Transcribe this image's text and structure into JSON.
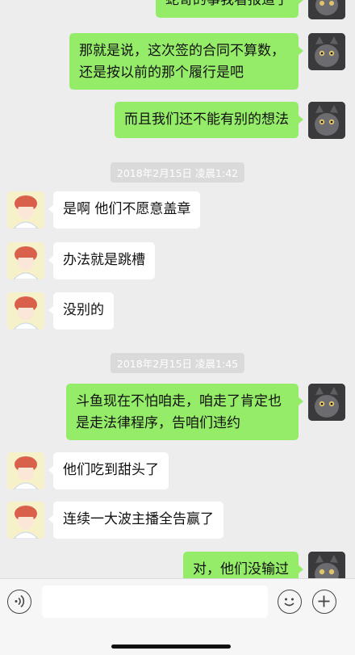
{
  "messages": [
    {
      "text": "蛇哥的事我看报道了"
    },
    {
      "text": "那就是说，这次签的合同不算数，还是按以前的那个履行是吧"
    },
    {
      "text": "而且我们还不能有别的想法"
    },
    {
      "text": "2018年2月15日 凌晨1:42"
    },
    {
      "text": "是啊 他们不愿意盖章"
    },
    {
      "text": "办法就是跳槽"
    },
    {
      "text": "没别的"
    },
    {
      "text": "2018年2月15日 凌晨1:45"
    },
    {
      "text": "斗鱼现在不怕咱走，咱走了肯定也是走法律程序，告咱们违约"
    },
    {
      "text": "他们吃到甜头了"
    },
    {
      "text": "连续一大波主播全告赢了"
    },
    {
      "text": "对，他们没输过"
    }
  ],
  "input_bar": {
    "voice_icon": "voice-icon",
    "emoji_icon": "emoji-icon",
    "add_icon": "add-icon",
    "value": ""
  },
  "colors": {
    "background": "#ededed",
    "outgoing_bubble": "#95ec69",
    "incoming_bubble": "#ffffff",
    "timestamp_bg": "#dadada"
  }
}
